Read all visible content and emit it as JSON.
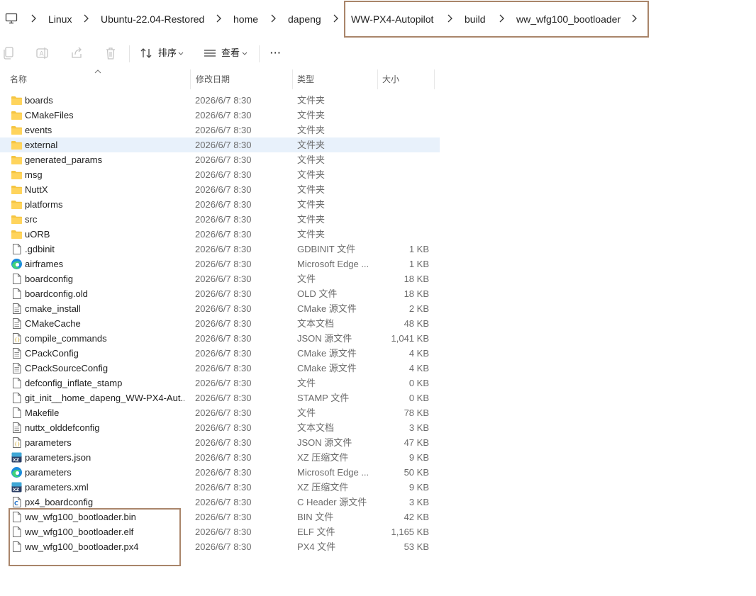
{
  "breadcrumb": [
    "Linux",
    "Ubuntu-22.04-Restored",
    "home",
    "dapeng",
    "WW-PX4-Autopilot",
    "build",
    "ww_wfg100_bootloader"
  ],
  "toolbar": {
    "sort_label": "排序",
    "view_label": "查看",
    "more_label": "···"
  },
  "columns": {
    "name": "名称",
    "date": "修改日期",
    "type": "类型",
    "size": "大小"
  },
  "colors": {
    "selected_row": "#e8f1fb",
    "highlight_box": "#a9856a",
    "folder": "#f5c542"
  },
  "files": [
    {
      "name": "boards",
      "date": "2026/6/7 8:30",
      "type": "文件夹",
      "size": "",
      "icon": "folder"
    },
    {
      "name": "CMakeFiles",
      "date": "2026/6/7 8:30",
      "type": "文件夹",
      "size": "",
      "icon": "folder"
    },
    {
      "name": "events",
      "date": "2026/6/7 8:30",
      "type": "文件夹",
      "size": "",
      "icon": "folder"
    },
    {
      "name": "external",
      "date": "2026/6/7 8:30",
      "type": "文件夹",
      "size": "",
      "icon": "folder",
      "selected": true
    },
    {
      "name": "generated_params",
      "date": "2026/6/7 8:30",
      "type": "文件夹",
      "size": "",
      "icon": "folder"
    },
    {
      "name": "msg",
      "date": "2026/6/7 8:30",
      "type": "文件夹",
      "size": "",
      "icon": "folder"
    },
    {
      "name": "NuttX",
      "date": "2026/6/7 8:30",
      "type": "文件夹",
      "size": "",
      "icon": "folder"
    },
    {
      "name": "platforms",
      "date": "2026/6/7 8:30",
      "type": "文件夹",
      "size": "",
      "icon": "folder"
    },
    {
      "name": "src",
      "date": "2026/6/7 8:30",
      "type": "文件夹",
      "size": "",
      "icon": "folder"
    },
    {
      "name": "uORB",
      "date": "2026/6/7 8:30",
      "type": "文件夹",
      "size": "",
      "icon": "folder"
    },
    {
      "name": ".gdbinit",
      "date": "2026/6/7 8:30",
      "type": "GDBINIT 文件",
      "size": "1 KB",
      "icon": "file"
    },
    {
      "name": "airframes",
      "date": "2026/6/7 8:30",
      "type": "Microsoft Edge ...",
      "size": "1 KB",
      "icon": "edge"
    },
    {
      "name": "boardconfig",
      "date": "2026/6/7 8:30",
      "type": "文件",
      "size": "18 KB",
      "icon": "file"
    },
    {
      "name": "boardconfig.old",
      "date": "2026/6/7 8:30",
      "type": "OLD 文件",
      "size": "18 KB",
      "icon": "file"
    },
    {
      "name": "cmake_install",
      "date": "2026/6/7 8:30",
      "type": "CMake 源文件",
      "size": "2 KB",
      "icon": "text"
    },
    {
      "name": "CMakeCache",
      "date": "2026/6/7 8:30",
      "type": "文本文档",
      "size": "48 KB",
      "icon": "text"
    },
    {
      "name": "compile_commands",
      "date": "2026/6/7 8:30",
      "type": "JSON 源文件",
      "size": "1,041 KB",
      "icon": "json"
    },
    {
      "name": "CPackConfig",
      "date": "2026/6/7 8:30",
      "type": "CMake 源文件",
      "size": "4 KB",
      "icon": "text"
    },
    {
      "name": "CPackSourceConfig",
      "date": "2026/6/7 8:30",
      "type": "CMake 源文件",
      "size": "4 KB",
      "icon": "text"
    },
    {
      "name": "defconfig_inflate_stamp",
      "date": "2026/6/7 8:30",
      "type": "文件",
      "size": "0 KB",
      "icon": "file"
    },
    {
      "name": "git_init__home_dapeng_WW-PX4-Aut...",
      "date": "2026/6/7 8:30",
      "type": "STAMP 文件",
      "size": "0 KB",
      "icon": "file"
    },
    {
      "name": "Makefile",
      "date": "2026/6/7 8:30",
      "type": "文件",
      "size": "78 KB",
      "icon": "file"
    },
    {
      "name": "nuttx_olddefconfig",
      "date": "2026/6/7 8:30",
      "type": "文本文档",
      "size": "3 KB",
      "icon": "text"
    },
    {
      "name": "parameters",
      "date": "2026/6/7 8:30",
      "type": "JSON 源文件",
      "size": "47 KB",
      "icon": "json"
    },
    {
      "name": "parameters.json",
      "date": "2026/6/7 8:30",
      "type": "XZ 压缩文件",
      "size": "9 KB",
      "icon": "xz"
    },
    {
      "name": "parameters",
      "date": "2026/6/7 8:30",
      "type": "Microsoft Edge ...",
      "size": "50 KB",
      "icon": "edge"
    },
    {
      "name": "parameters.xml",
      "date": "2026/6/7 8:30",
      "type": "XZ 压缩文件",
      "size": "9 KB",
      "icon": "xz"
    },
    {
      "name": "px4_boardconfig",
      "date": "2026/6/7 8:30",
      "type": "C Header 源文件",
      "size": "3 KB",
      "icon": "cheader"
    },
    {
      "name": "ww_wfg100_bootloader.bin",
      "date": "2026/6/7 8:30",
      "type": "BIN 文件",
      "size": "42 KB",
      "icon": "file"
    },
    {
      "name": "ww_wfg100_bootloader.elf",
      "date": "2026/6/7 8:30",
      "type": "ELF 文件",
      "size": "1,165 KB",
      "icon": "file"
    },
    {
      "name": "ww_wfg100_bootloader.px4",
      "date": "2026/6/7 8:30",
      "type": "PX4 文件",
      "size": "53 KB",
      "icon": "file"
    }
  ]
}
